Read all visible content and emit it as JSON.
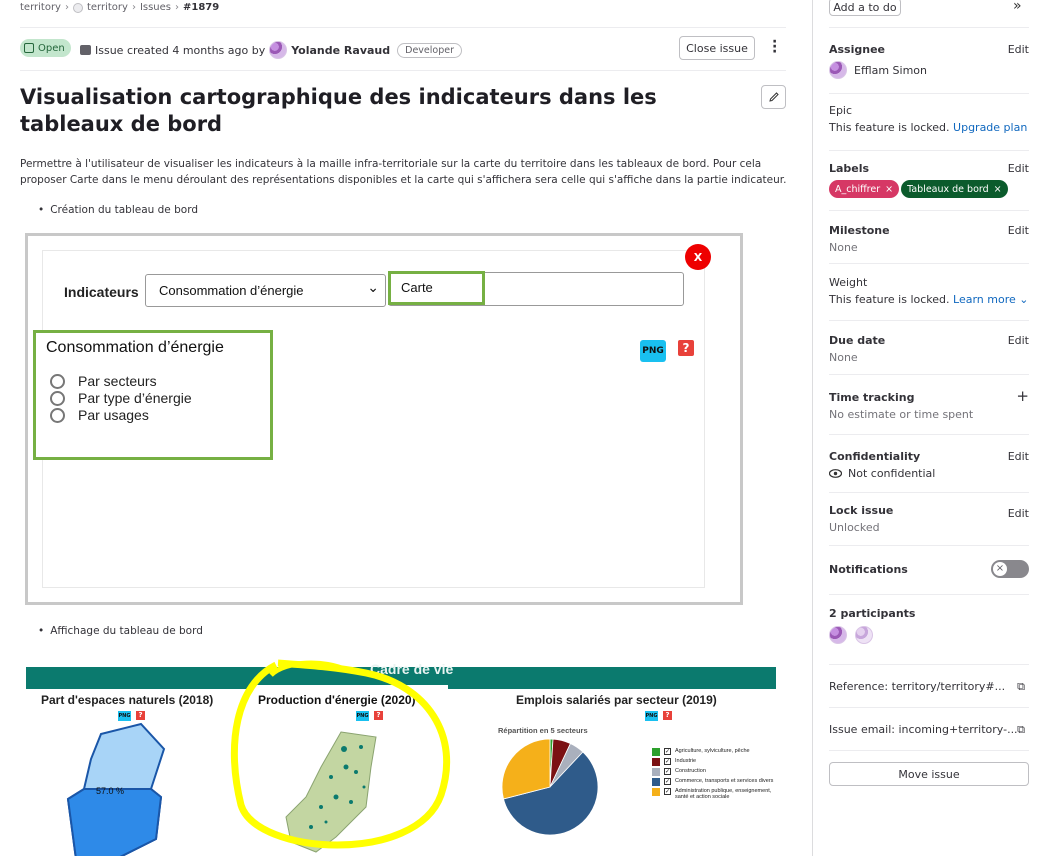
{
  "breadcrumb": {
    "items": [
      "territory",
      "territory",
      "Issues"
    ],
    "current": "#1879"
  },
  "header": {
    "status": "Open",
    "meta_text": "Issue created 4 months ago by",
    "author": "Yolande Ravaud",
    "role": "Developer",
    "close_button": "Close issue"
  },
  "issue": {
    "title": "Visualisation cartographique des indicateurs dans les tableaux de bord",
    "description": "Permettre à l'utilisateur de visualiser les indicateurs à la maille infra-territoriale sur la carte du territoire dans les tableaux de bord. Pour cela proposer Carte dans le menu déroulant des représentations disponibles et la carte qui s'affichera sera celle qui s'affiche dans la partie indicateur.",
    "bullet1": "Création du tableau de bord",
    "bullet2": "Affichage du tableau de bord"
  },
  "screenshot1": {
    "close_x": "X",
    "indicator_label": "Indicateurs",
    "dropdown_value": "Consommation d’énergie",
    "representation_value": "Carte",
    "panel_title": "Consommation d’énergie",
    "radios": [
      "Par secteurs",
      "Par type d’énergie",
      "Par usages"
    ],
    "png_label": "PNG",
    "help_label": "?"
  },
  "screenshot2": {
    "banner": "Cadre de vie",
    "chart1_title": "Part d'espaces naturels (2018)",
    "chart1_value": "57.0 %",
    "chart2_title": "Production d'énergie (2020)",
    "chart3_title": "Emplois salariés par secteur (2019)",
    "chart3_subtitle": "Répartition en 5 secteurs",
    "png_label": "PNG",
    "help_label": "?",
    "chart_data": {
      "type": "pie",
      "categories": [
        "Agriculture, sylviculture, pêche",
        "Industrie",
        "Construction",
        "Commerce, transports et services divers",
        "Administration publique, enseignement, santé et action sociale"
      ],
      "values": [
        1,
        6,
        5,
        59,
        29
      ],
      "colors": [
        "#2ca02c",
        "#7b1113",
        "#aab0bd",
        "#2f5b8a",
        "#f5b01a"
      ]
    }
  },
  "sidebar": {
    "todo_button": "Add a to do",
    "collapse_icon": "»",
    "assignee": {
      "title": "Assignee",
      "edit": "Edit",
      "name": "Efflam Simon"
    },
    "epic": {
      "title": "Epic",
      "text": "This feature is locked.",
      "link": "Upgrade plan"
    },
    "labels": {
      "title": "Labels",
      "edit": "Edit",
      "items": [
        {
          "text": "A_chiffrer",
          "color": "#d63865"
        },
        {
          "text": "Tableaux de bord",
          "color": "#0b5b2c"
        }
      ]
    },
    "milestone": {
      "title": "Milestone",
      "edit": "Edit",
      "value": "None"
    },
    "weight": {
      "title": "Weight",
      "text": "This feature is locked.",
      "link": "Learn more"
    },
    "due_date": {
      "title": "Due date",
      "edit": "Edit",
      "value": "None"
    },
    "time_tracking": {
      "title": "Time tracking",
      "value": "No estimate or time spent",
      "add": "+"
    },
    "confidentiality": {
      "title": "Confidentiality",
      "edit": "Edit",
      "value": "Not confidential"
    },
    "lock": {
      "title": "Lock issue",
      "edit": "Edit",
      "value": "Unlocked"
    },
    "notifications": {
      "title": "Notifications"
    },
    "participants": {
      "title": "2 participants"
    },
    "reference": "Reference: territory/territory#...",
    "email": "Issue email: incoming+territory-...",
    "move_button": "Move issue"
  }
}
